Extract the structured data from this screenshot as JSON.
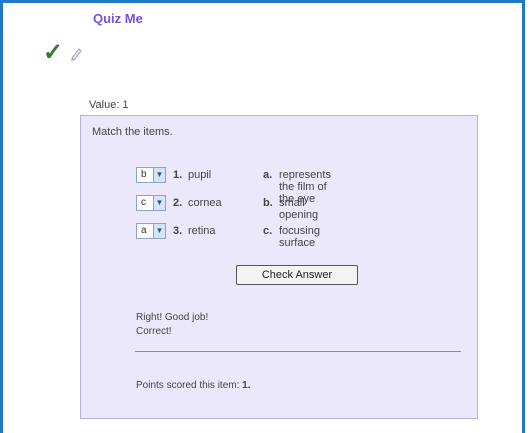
{
  "quiz": {
    "title": "Quiz Me"
  },
  "value_label": "Value: 1",
  "instruction": "Match the items.",
  "items": [
    {
      "selected": "b",
      "number": "1.",
      "term": "pupil",
      "letter": "a.",
      "definition": "represents the film of the eye"
    },
    {
      "selected": "c",
      "number": "2.",
      "term": "cornea",
      "letter": "b.",
      "definition": "small opening"
    },
    {
      "selected": "a",
      "number": "3.",
      "term": "retina",
      "letter": "c.",
      "definition": "focusing surface"
    }
  ],
  "check_button": "Check Answer",
  "feedback": {
    "line1": "Right! Good job!",
    "line2": "Correct!"
  },
  "points": {
    "label": "Points scored this item:",
    "value": "1."
  },
  "icons": {
    "check": "checkmark-icon",
    "edit": "pencil-icon",
    "dropdown": "chevron-down-icon"
  },
  "colors": {
    "frame": "#1f78c8",
    "title": "#7a4fd9",
    "panel": "#ebe8fb",
    "check": "#2f7d2a"
  }
}
